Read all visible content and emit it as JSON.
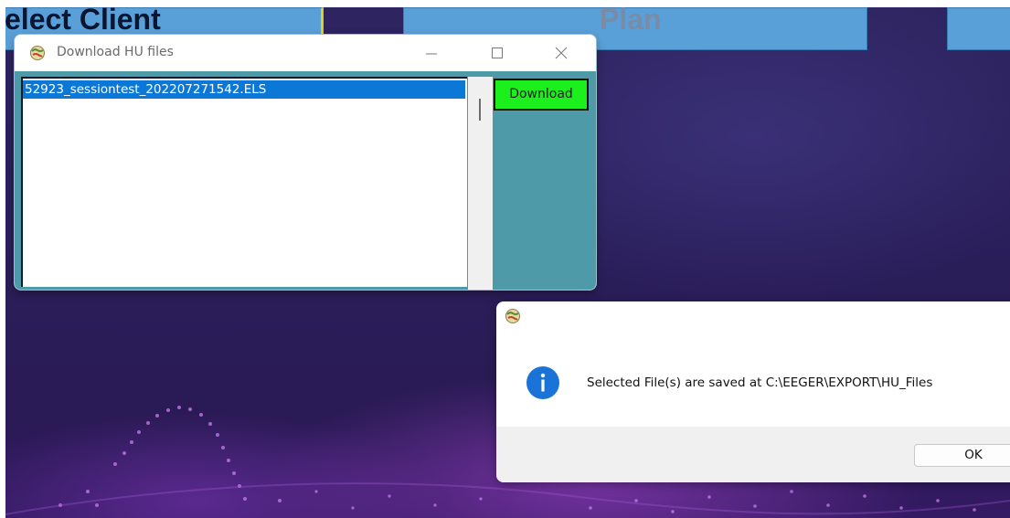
{
  "background_app": {
    "select_client_label": "elect Client",
    "plan_label": "Plan"
  },
  "download_window": {
    "title": "Download HU files",
    "app_icon": "app-globe-icon",
    "files": [
      "52923_sessiontest_202207271542.ELS"
    ],
    "selected_index": 0,
    "download_label": "Download",
    "colors": {
      "client_bg": "#4e9aa8",
      "download_bg": "#1cf01c",
      "selection": "#0b78d7"
    }
  },
  "message_box": {
    "icon": "info-icon",
    "text": "Selected File(s) are saved at C:\\EEGER\\EXPORT\\HU_Files",
    "ok_label": "OK"
  }
}
